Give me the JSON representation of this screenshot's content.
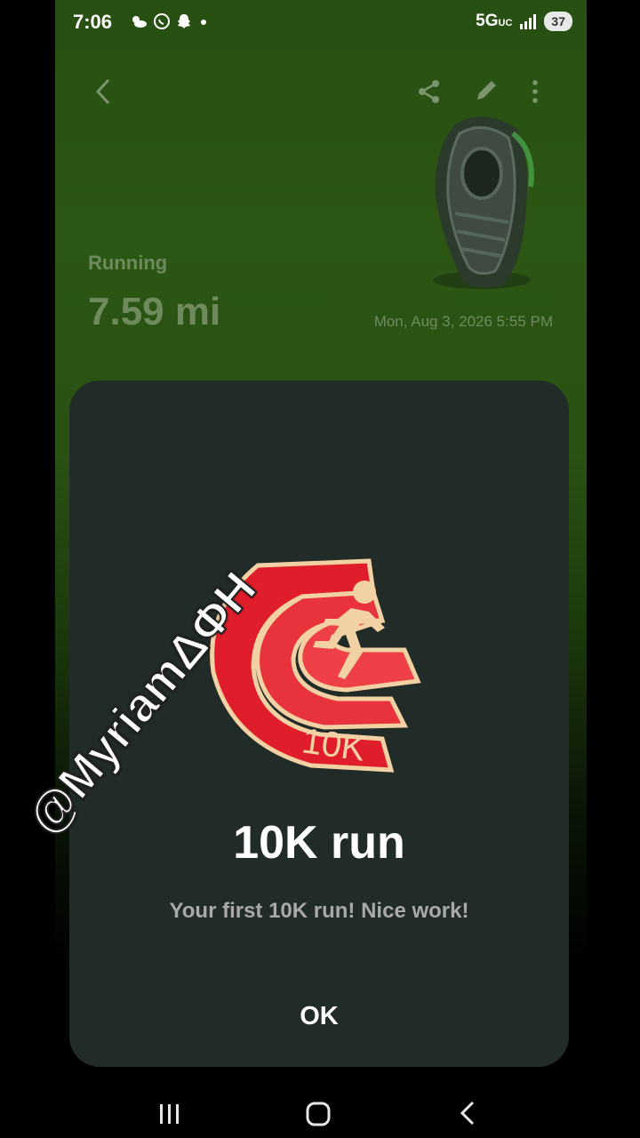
{
  "status_bar": {
    "time": "7:06",
    "network": "5G",
    "network_sub": "UC",
    "battery": "37"
  },
  "top_bar": {
    "icons": [
      "back-icon",
      "share-icon",
      "edit-icon",
      "more-icon"
    ]
  },
  "activity": {
    "type": "Running",
    "distance": "7.59 mi",
    "datetime": "Mon, Aug 3, 2026 5:55 PM"
  },
  "dialog": {
    "badge_text": "10K",
    "title": "10K run",
    "message": "Your first 10K run! Nice work!",
    "ok_label": "OK"
  },
  "watermark": "@MyriamΔΦΗ",
  "colors": {
    "background_green": "#2a5213",
    "dialog_bg": "#212b28",
    "badge_red": "#e01e2b",
    "badge_gold": "#f2d2a4"
  }
}
